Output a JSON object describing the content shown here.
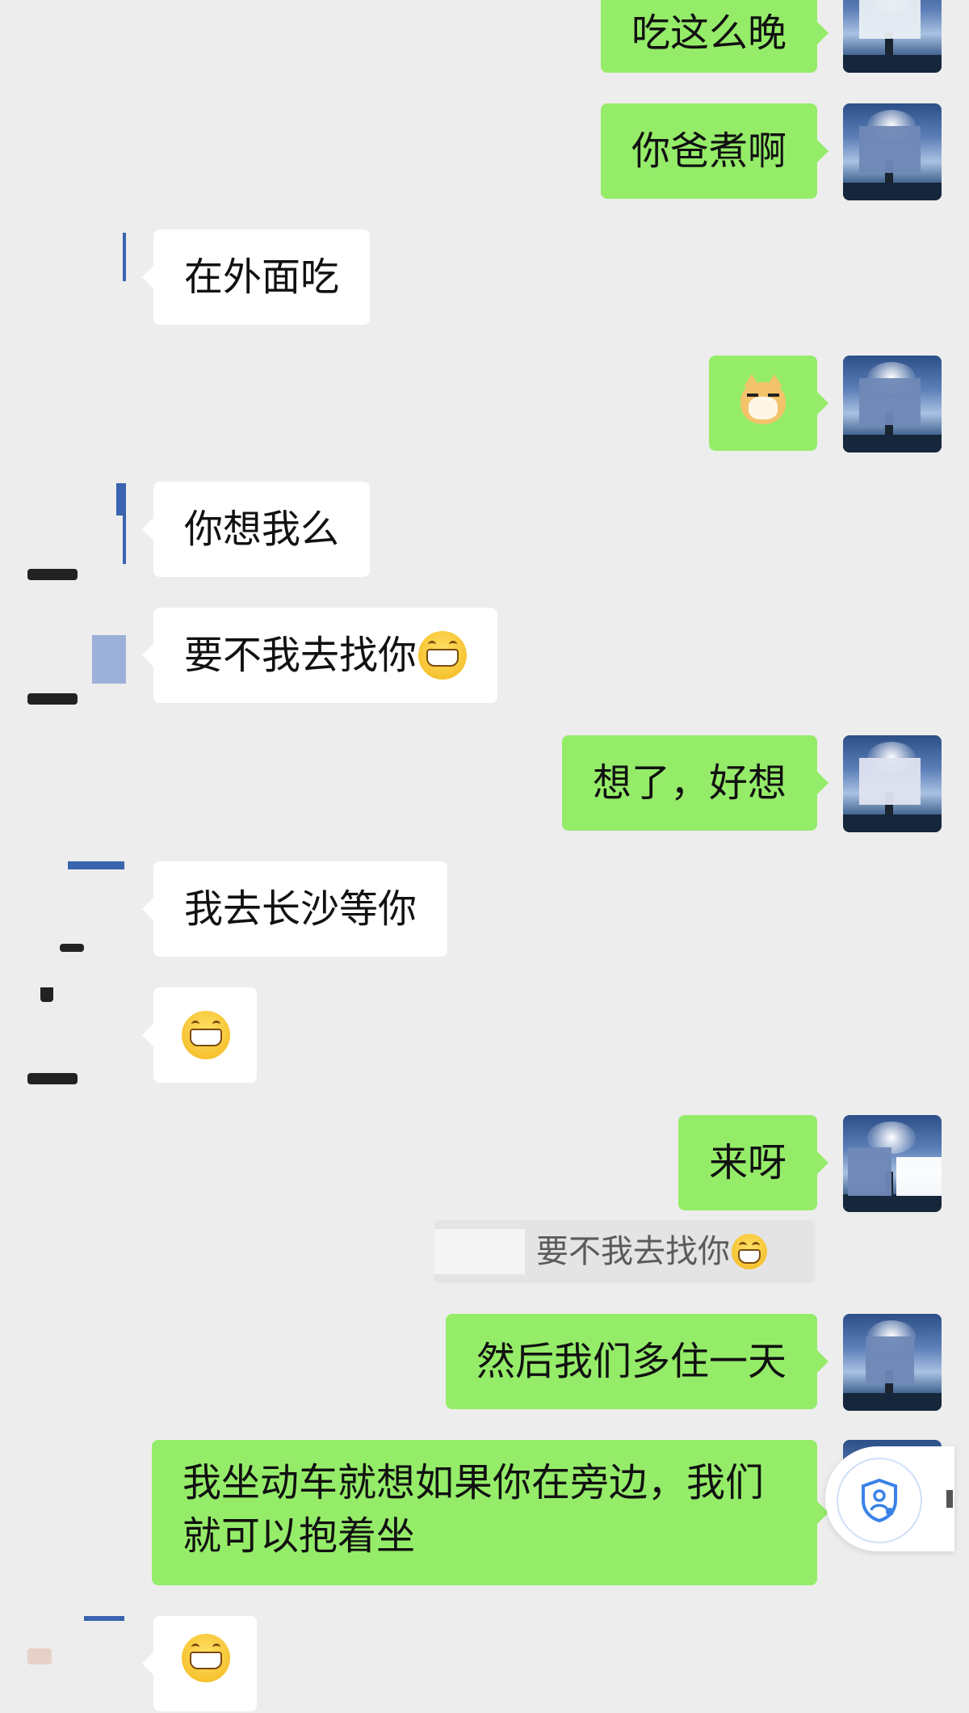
{
  "messages": [
    {
      "side": "sent",
      "text": "吃这么晚"
    },
    {
      "side": "sent",
      "text": "你爸煮啊"
    },
    {
      "side": "recv",
      "text": "在外面吃"
    },
    {
      "side": "sent",
      "emoji": "dog-face-emoji"
    },
    {
      "side": "recv",
      "text": "你想我么"
    },
    {
      "side": "recv",
      "text": "要不我去找你"
    },
    {
      "side": "sent",
      "text": "想了，好想"
    },
    {
      "side": "recv",
      "text": "我去长沙等你"
    },
    {
      "side": "recv",
      "emoji": "grinning-face-emoji"
    },
    {
      "side": "sent",
      "text": "来呀"
    },
    {
      "side": "sent",
      "text": "然后我们多住一天",
      "quote": "要不我去找你"
    },
    {
      "side": "sent",
      "text": "我坐动车就想如果你在旁边，我们就可以抱着坐"
    },
    {
      "side": "recv",
      "emoji": "grinning-face-emoji"
    }
  ],
  "colors": {
    "sent_bubble": "#95ec69",
    "recv_bubble": "#ffffff",
    "background": "#ededed"
  },
  "floating_button": {
    "icon": "shield-person-icon"
  }
}
